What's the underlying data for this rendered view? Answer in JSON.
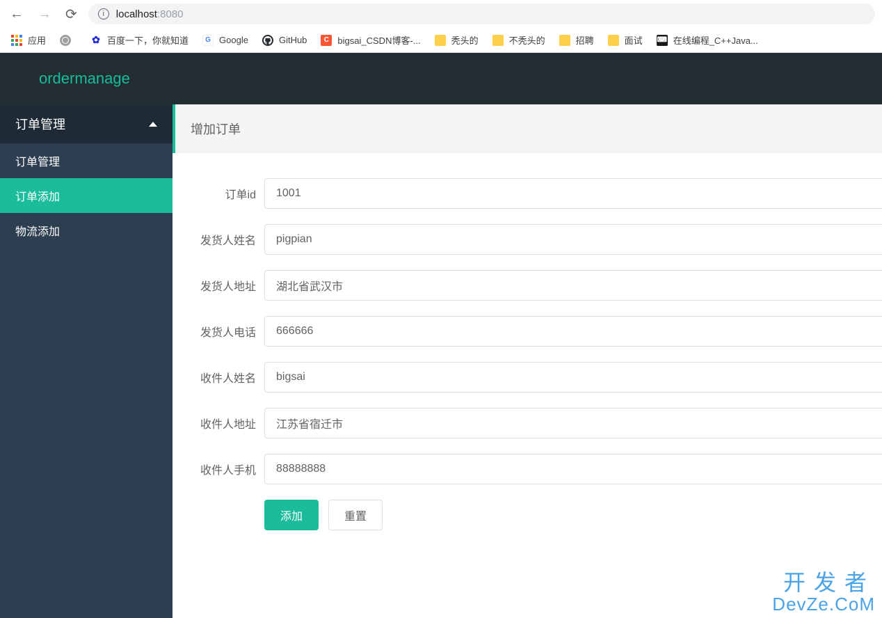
{
  "browser": {
    "url_host": "localhost",
    "url_port": ":8080"
  },
  "bookmarks": {
    "apps": "应用",
    "items": [
      {
        "label": ""
      },
      {
        "label": "百度一下，你就知道"
      },
      {
        "label": "Google"
      },
      {
        "label": "GitHub"
      },
      {
        "label": "bigsai_CSDN博客-..."
      },
      {
        "label": "秃头的"
      },
      {
        "label": "不秃头的"
      },
      {
        "label": "招聘"
      },
      {
        "label": "面试"
      },
      {
        "label": "在线编程_C++Java..."
      }
    ]
  },
  "header": {
    "brand": "ordermanage"
  },
  "sidebar": {
    "parent": "订单管理",
    "items": [
      {
        "label": "订单管理",
        "active": false
      },
      {
        "label": "订单添加",
        "active": true
      },
      {
        "label": "物流添加",
        "active": false
      }
    ]
  },
  "panel": {
    "title": "增加订单"
  },
  "form": {
    "fields": [
      {
        "label": "订单id",
        "value": "1001"
      },
      {
        "label": "发货人姓名",
        "value": "pigpian"
      },
      {
        "label": "发货人地址",
        "value": "湖北省武汉市"
      },
      {
        "label": "发货人电话",
        "value": "666666"
      },
      {
        "label": "收件人姓名",
        "value": "bigsai"
      },
      {
        "label": "收件人地址",
        "value": "江苏省宿迁市"
      },
      {
        "label": "收件人手机",
        "value": "88888888"
      }
    ],
    "submit": "添加",
    "reset": "重置"
  },
  "watermark": {
    "line1": "开发者",
    "line2": "DevZe.CoM"
  }
}
